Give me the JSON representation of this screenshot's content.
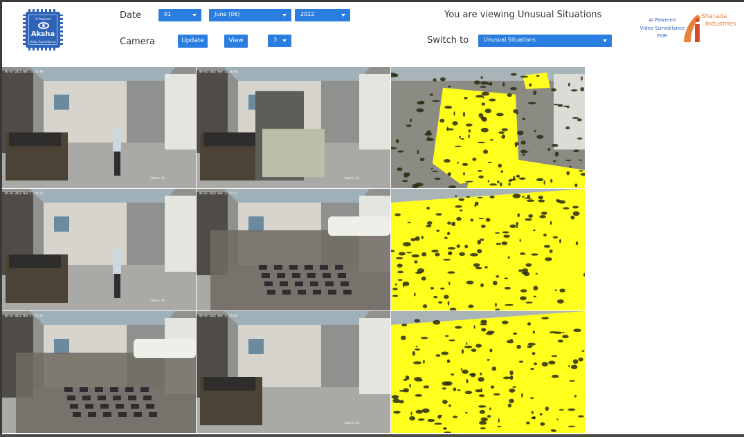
{
  "logo": {
    "line1": "AI Powered",
    "name": "Aksha",
    "line3": "Video Surveillance"
  },
  "date": {
    "label": "Date",
    "day": "01",
    "month": "June (06)",
    "year": "2022"
  },
  "camera": {
    "label": "Camera",
    "update_label": "Update",
    "view_label": "View",
    "number": "3"
  },
  "switch": {
    "label": "Switch to",
    "value": "Unusual Situations"
  },
  "viewing_text": "You are viewing Unusual Situations",
  "brand": {
    "line1": "AI Powered",
    "line2": "Video Surveillance",
    "line3": "FOR",
    "name1": "Sharada",
    "name2": "Industries"
  },
  "feeds": [
    {
      "timestamp": "06-01-2022 Wed 16:24:09",
      "camera": "Camera 03",
      "kind": "normal"
    },
    {
      "timestamp": "06-01-2022 Wed 16:30:00",
      "camera": "Camera 03",
      "kind": "normal"
    },
    {
      "timestamp": "",
      "camera": "",
      "kind": "highlight"
    },
    {
      "timestamp": "06-01-2022 Wed 17:50:25",
      "camera": "Camera 03",
      "kind": "normal"
    },
    {
      "timestamp": "06-01-2022 Wed 17:52:13",
      "camera": "",
      "kind": "normal"
    },
    {
      "timestamp": "",
      "camera": "",
      "kind": "highlight"
    },
    {
      "timestamp": "06-01-2022 Wed 17:52:13",
      "camera": "",
      "kind": "normal"
    },
    {
      "timestamp": "06-01-2022 Wed 17:54:07",
      "camera": "Camera 03",
      "kind": "normal"
    },
    {
      "timestamp": "",
      "camera": "",
      "kind": "highlight"
    }
  ],
  "colors": {
    "accent": "#2a7ee0",
    "brand_orange": "#e8823a",
    "highlight": "#ffff1e"
  }
}
